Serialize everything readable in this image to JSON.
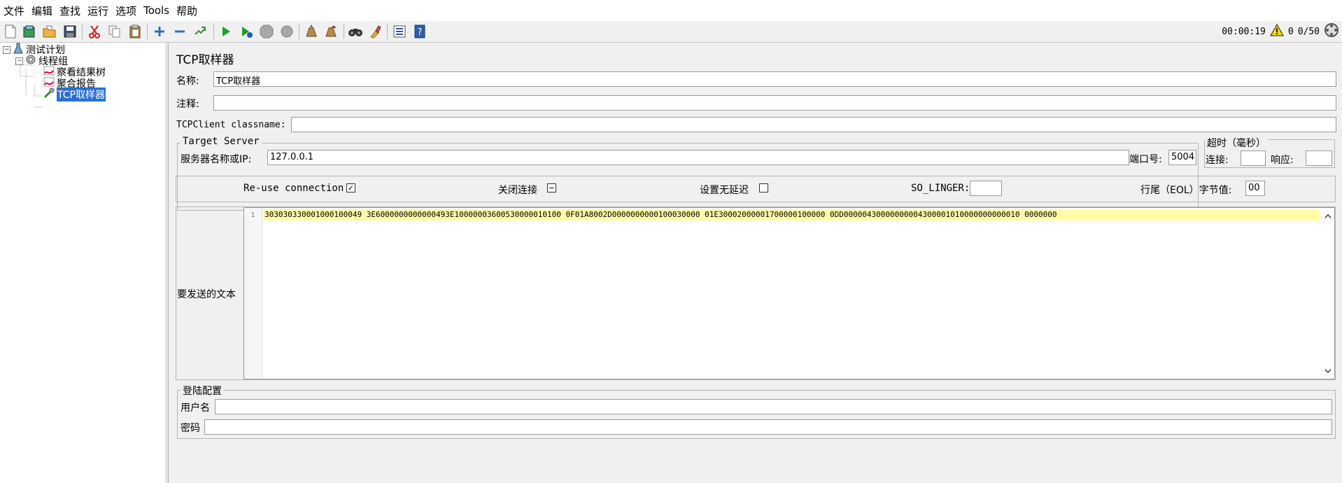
{
  "menu": [
    {
      "label": "文件"
    },
    {
      "label": "编辑"
    },
    {
      "label": "查找"
    },
    {
      "label": "运行"
    },
    {
      "label": "选项"
    },
    {
      "label": "Tools"
    },
    {
      "label": "帮助"
    }
  ],
  "status": {
    "elapsed": "00:00:19",
    "errors": "0",
    "threads": "0/50"
  },
  "tree": {
    "root": "测试计划",
    "thread_group": "线程组",
    "children": [
      "察看结果树",
      "聚合报告",
      "TCP取样器"
    ],
    "selected": "TCP取样器"
  },
  "form": {
    "title": "TCP取样器",
    "name_label": "名称:",
    "name_value": "TCP取样器",
    "comment_label": "注释:",
    "comment_value": "",
    "classname_label": "TCPClient classname:",
    "classname_value": "",
    "target_server": {
      "title": "Target Server",
      "server_label": "服务器名称或IP:",
      "server_value": "127.0.0.1",
      "port_label": "端口号:",
      "port_value": "5004"
    },
    "timeout": {
      "title": "超时（毫秒）",
      "connect_label": "连接:",
      "connect_value": "",
      "response_label": "响应:",
      "response_value": ""
    },
    "options": {
      "reuse_label": "Re-use connection",
      "reuse_checked": true,
      "close_label": "关闭连接",
      "close_state": "indeterminate",
      "nodelay_label": "设置无延迟",
      "nodelay_checked": false,
      "solinger_label": "SO_LINGER:",
      "solinger_value": "",
      "eol_label": "行尾（EOL）字节值:",
      "eol_value": "00"
    },
    "text_label": "要发送的文本",
    "text_line_number": "1",
    "text_value": "303030330001000100049 3E6000000000000493E10000003600530000010100 0F01A8002D0000000000100030000 01E30002000001700000100000 0DD00000430000000004300001010000000000010 0000000",
    "login": {
      "title": "登陆配置",
      "username_label": "用户名",
      "username_value": "",
      "password_label": "密码",
      "password_value": ""
    }
  }
}
